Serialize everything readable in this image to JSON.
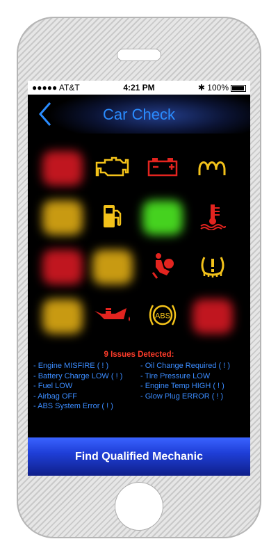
{
  "status": {
    "carrier": "●●●●● AT&T",
    "time": "4:21 PM",
    "battery": "100%"
  },
  "nav": {
    "title": "Car Check"
  },
  "lights": [
    {
      "name": "red-warning-blob",
      "kind": "blob",
      "color": "#c0161f"
    },
    {
      "name": "check-engine-icon",
      "kind": "icon",
      "color": "#f3c21a"
    },
    {
      "name": "battery-icon",
      "kind": "icon",
      "color": "#e3241f"
    },
    {
      "name": "glow-plug-icon",
      "kind": "icon",
      "color": "#f3c21a"
    },
    {
      "name": "amber-warning-blob",
      "kind": "blob",
      "color": "#c89a12"
    },
    {
      "name": "fuel-icon",
      "kind": "icon",
      "color": "#f3c21a"
    },
    {
      "name": "green-indicator-blob",
      "kind": "blob",
      "color": "#45d21f"
    },
    {
      "name": "engine-temp-icon",
      "kind": "icon",
      "color": "#e3241f"
    },
    {
      "name": "red-warning-blob",
      "kind": "blob",
      "color": "#c0161f"
    },
    {
      "name": "amber-warning-blob",
      "kind": "blob",
      "color": "#c89a12"
    },
    {
      "name": "airbag-icon",
      "kind": "icon",
      "color": "#e3241f"
    },
    {
      "name": "tire-pressure-icon",
      "kind": "icon",
      "color": "#f3c21a"
    },
    {
      "name": "amber-warning-blob",
      "kind": "blob",
      "color": "#c89a12"
    },
    {
      "name": "oil-change-icon",
      "kind": "icon",
      "color": "#e3241f"
    },
    {
      "name": "abs-icon",
      "kind": "icon",
      "color": "#f3c21a"
    },
    {
      "name": "red-warning-blob",
      "kind": "blob",
      "color": "#c0161f"
    }
  ],
  "issues": {
    "heading": "9 Issues Detected:",
    "left": [
      "- Engine MISFIRE ( ! )",
      "- Battery Charge LOW ( ! )",
      "- Fuel LOW",
      "- Airbag OFF",
      "- ABS System Error ( ! )"
    ],
    "right": [
      "- Oil Change Required ( ! )",
      "- Tire Pressure LOW",
      "- Engine Temp HIGH ( ! )",
      "- Glow Plug ERROR ( ! )"
    ]
  },
  "button": {
    "label": "Find Qualified Mechanic"
  }
}
